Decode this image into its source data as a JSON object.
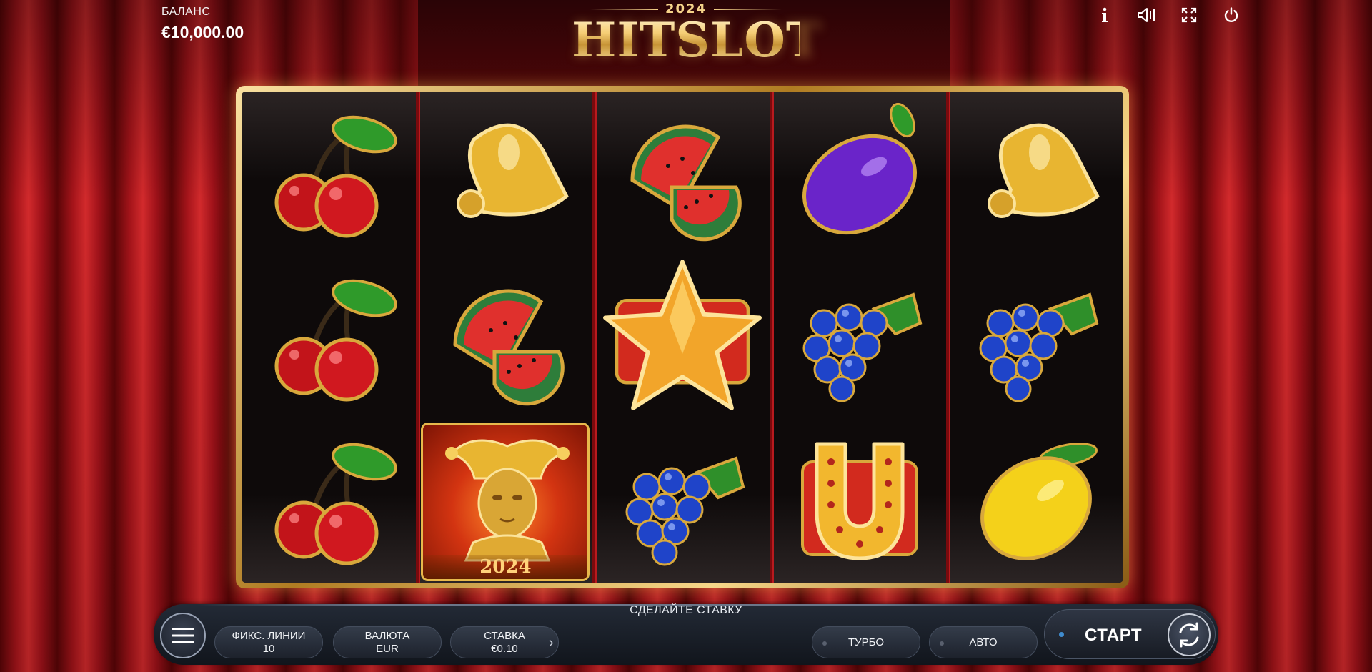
{
  "balance": {
    "label": "БАЛАНС",
    "value": "€10,000.00"
  },
  "logo": {
    "year": "2024",
    "name": "HITSLOT"
  },
  "top_icons": [
    "info-icon",
    "sound-icon",
    "fullscreen-icon",
    "power-icon"
  ],
  "reels": [
    [
      "cherry",
      "cherry",
      "cherry"
    ],
    [
      "bell",
      "watermelon",
      "joker"
    ],
    [
      "watermelon",
      "star",
      "grapes"
    ],
    [
      "plum",
      "grapes",
      "horseshoe"
    ],
    [
      "bell",
      "grapes",
      "lemon"
    ]
  ],
  "joker_tile_label": "2024",
  "bottom_bar": {
    "prompt": "СДЕЛАЙТЕ СТАВКУ",
    "lines": {
      "label": "ФИКС. ЛИНИИ",
      "value": "10"
    },
    "currency": {
      "label": "ВАЛЮТА",
      "value": "EUR"
    },
    "bet": {
      "label": "СТАВКА",
      "value": "€0.10"
    },
    "turbo": "ТУРБО",
    "auto": "АВТО",
    "start": "СТАРТ"
  },
  "colors": {
    "accent_gold": "#f3d07f",
    "curtain_red": "#c2202a",
    "bar_dark": "#1a1f29",
    "start_dot": "#3f8ccf"
  }
}
